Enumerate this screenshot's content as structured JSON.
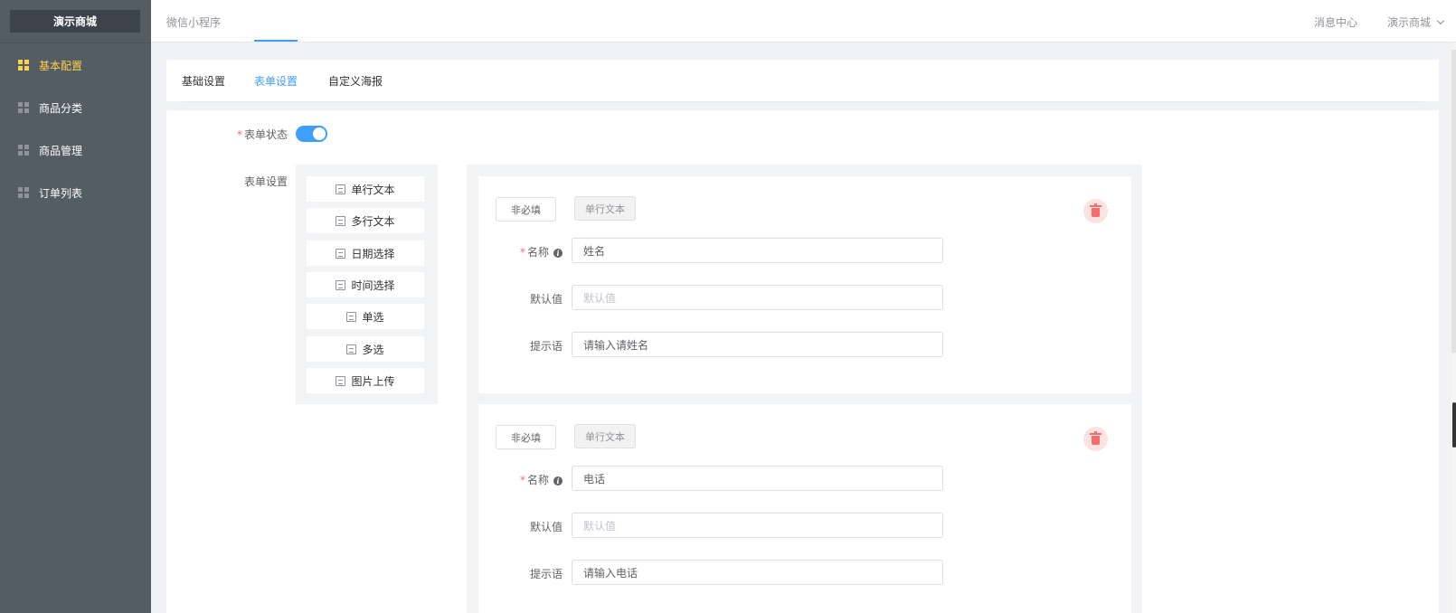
{
  "sidebar": {
    "brand": "演示商城",
    "items": [
      {
        "label": "基本配置",
        "active": true
      },
      {
        "label": "商品分类",
        "active": false
      },
      {
        "label": "商品管理",
        "active": false
      },
      {
        "label": "订单列表",
        "active": false
      }
    ]
  },
  "header": {
    "title": "微信小程序",
    "message_center": "消息中心",
    "user": "演示商城"
  },
  "tabs": [
    {
      "label": "基础设置",
      "active": false
    },
    {
      "label": "表单设置",
      "active": true
    },
    {
      "label": "自定义海报",
      "active": false
    }
  ],
  "form": {
    "status_label": "表单状态",
    "status_on": true,
    "settings_label": "表单设置",
    "palette": [
      "单行文本",
      "多行文本",
      "日期选择",
      "时间选择",
      "单选",
      "多选",
      "图片上传"
    ],
    "fields": [
      {
        "required_btn": "非必填",
        "type_btn": "单行文本",
        "name_label": "名称",
        "name_value": "姓名",
        "default_label": "默认值",
        "default_placeholder": "默认值",
        "hint_label": "提示语",
        "hint_value": "请输入请姓名"
      },
      {
        "required_btn": "非必填",
        "type_btn": "单行文本",
        "name_label": "名称",
        "name_value": "电话",
        "default_label": "默认值",
        "default_placeholder": "默认值",
        "hint_label": "提示语",
        "hint_value": "请输入电话"
      }
    ]
  },
  "colors": {
    "sidebar_bg": "#545c64",
    "active_menu": "#ffd04b",
    "primary": "#409eff",
    "danger": "#f56c6c"
  }
}
